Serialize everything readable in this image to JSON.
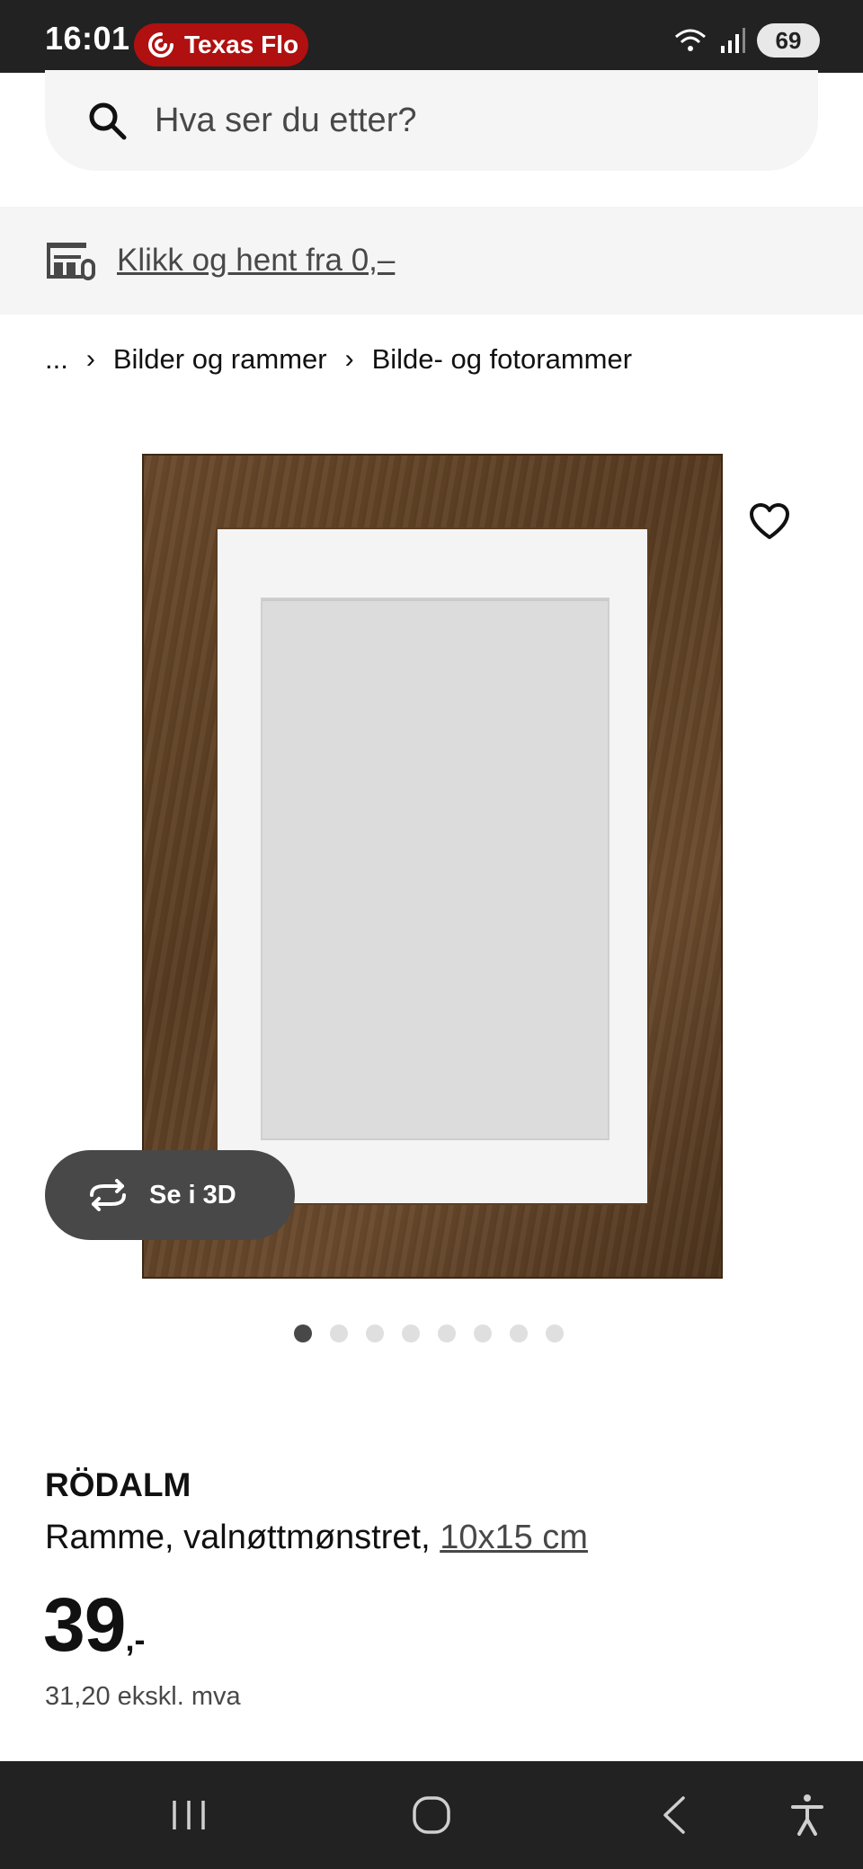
{
  "status_bar": {
    "time": "16:01",
    "live_activity": "Texas Flo",
    "battery": "69"
  },
  "search": {
    "placeholder": "Hva ser du etter?"
  },
  "promo": {
    "text": "Klikk og hent fra 0,–"
  },
  "breadcrumb": {
    "ellipsis": "...",
    "items": [
      "Bilder og rammer",
      "Bilde- og fotorammer"
    ]
  },
  "gallery": {
    "view_3d_label": "Se i 3D",
    "dot_count": 8,
    "active_index": 0
  },
  "product": {
    "name": "RÖDALM",
    "description": "Ramme, valnøttmønstret, ",
    "size": "10x15 cm",
    "price_integer": "39",
    "price_suffix": ",-",
    "price_excl_vat": "31,20 ekskl. mva"
  },
  "colors": {
    "status_bar_bg": "#222222",
    "live_pill": "#b01010",
    "light_gray": "#f5f5f5",
    "button_dark": "#484848"
  }
}
